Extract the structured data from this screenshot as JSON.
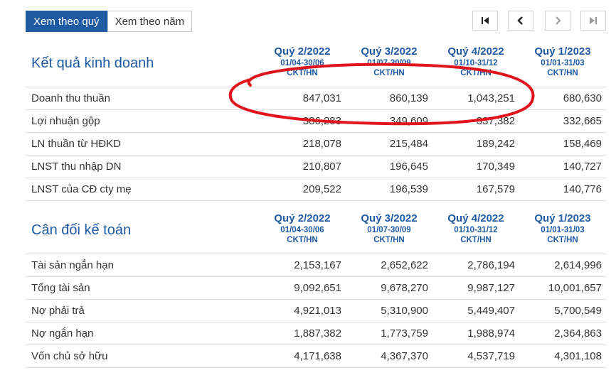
{
  "tabs": {
    "quarter": "Xem theo quý",
    "year": "Xem theo năm"
  },
  "pager_icons": [
    "first-page-icon",
    "prev-page-icon",
    "next-page-icon",
    "last-page-icon"
  ],
  "income": {
    "title": "Kết quả kinh doanh",
    "columns": [
      {
        "quarter": "Quý 2/2022",
        "range": "01/04-30/06",
        "unit": "CKT/HN"
      },
      {
        "quarter": "Quý 3/2022",
        "range": "01/07-30/09",
        "unit": "CKT/HN"
      },
      {
        "quarter": "Quý 4/2022",
        "range": "01/10-31/12",
        "unit": "CKT/HN"
      },
      {
        "quarter": "Quý 1/2023",
        "range": "01/01-31/03",
        "unit": "CKT/HN"
      }
    ],
    "rows": [
      {
        "label": "Doanh thu thuần",
        "values": [
          "847,031",
          "860,139",
          "1,043,251",
          "680,630"
        ]
      },
      {
        "label": "Lợi nhuận gộp",
        "values": [
          "386,283",
          "349,609",
          "337,382",
          "332,665"
        ]
      },
      {
        "label": "LN thuần từ HĐKD",
        "values": [
          "218,078",
          "215,484",
          "189,242",
          "158,469"
        ]
      },
      {
        "label": "LNST thu nhập DN",
        "values": [
          "210,807",
          "196,645",
          "170,349",
          "140,727"
        ]
      },
      {
        "label": "LNST của CĐ cty mẹ",
        "values": [
          "209,522",
          "196,539",
          "167,579",
          "140,776"
        ]
      }
    ]
  },
  "balance": {
    "title": "Cân đối kế toán",
    "columns": [
      {
        "quarter": "Quý 2/2022",
        "range": "01/04-30/06",
        "unit": "CKT/HN"
      },
      {
        "quarter": "Quý 3/2022",
        "range": "01/07-30/09",
        "unit": "CKT/HN"
      },
      {
        "quarter": "Quý 4/2022",
        "range": "01/10-31/12",
        "unit": "CKT/HN"
      },
      {
        "quarter": "Quý 1/2023",
        "range": "01/01-31/03",
        "unit": "CKT/HN"
      }
    ],
    "rows": [
      {
        "label": "Tài sản ngắn hạn",
        "values": [
          "2,153,167",
          "2,652,622",
          "2,786,194",
          "2,614,996"
        ]
      },
      {
        "label": "Tổng tài sản",
        "values": [
          "9,092,651",
          "9,678,270",
          "9,987,127",
          "10,001,657"
        ]
      },
      {
        "label": "Nợ phải trả",
        "values": [
          "4,921,013",
          "5,310,900",
          "5,449,407",
          "5,700,549"
        ]
      },
      {
        "label": "Nợ ngắn hạn",
        "values": [
          "1,887,382",
          "1,773,759",
          "1,988,974",
          "2,364,863"
        ]
      },
      {
        "label": "Vốn chủ sở hữu",
        "values": [
          "4,171,638",
          "4,367,370",
          "4,537,719",
          "4,301,108"
        ]
      }
    ]
  },
  "colors": {
    "accent": "#1f5aa3",
    "annotation": "#e0141c"
  }
}
